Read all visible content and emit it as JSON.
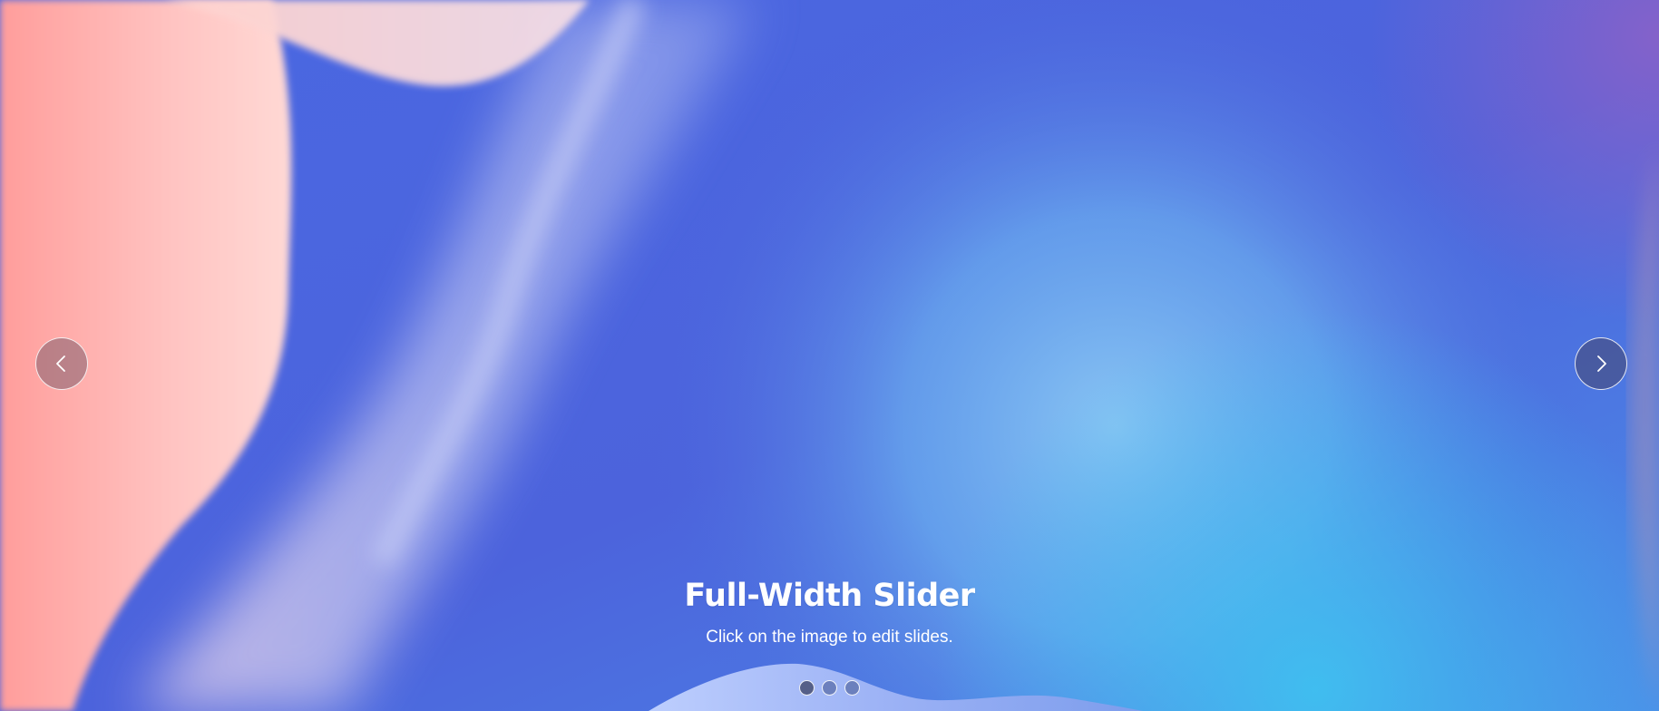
{
  "slider": {
    "title": "Full-Width Slider",
    "subtitle": "Click on the image to edit slides.",
    "prev_icon": "chevron-left-icon",
    "next_icon": "chevron-right-icon",
    "slides_count": 3,
    "active_slide": 1
  },
  "colors": {
    "background_blue": "#4a63dc",
    "pink": "#ff9a9a",
    "light_pink": "#ffd6d2",
    "cyan": "#4fc3f0",
    "text": "#ffffff"
  }
}
